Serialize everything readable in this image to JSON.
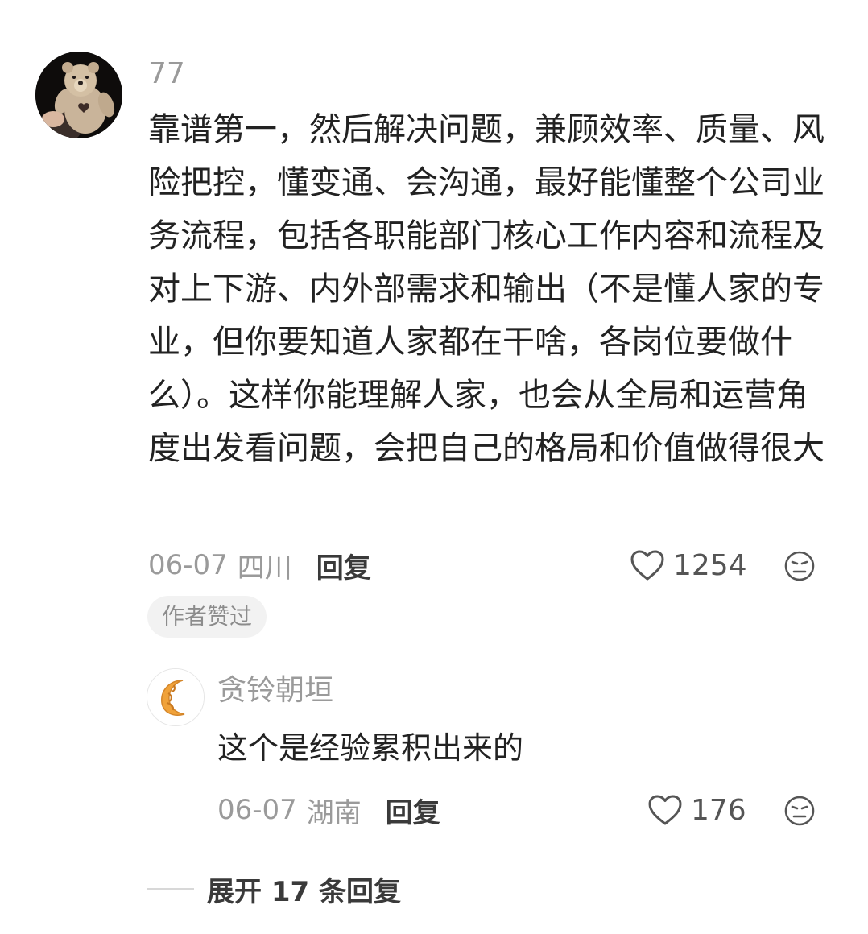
{
  "comment": {
    "username": "77",
    "text": "靠谱第一，然后解决问题，兼顾效率、质量、风险把控，懂变通、会沟通，最好能懂整个公司业务流程，包括各职能部门核心工作内容和流程及对上下游、内外部需求和输出（不是懂人家的专业，但你要知道人家都在干啥，各岗位要做什么）。这样你能理解人家，也会从全局和运营角度出发看问题，会把自己的格局和价值做得很大",
    "date": "06-07",
    "location": "四川",
    "reply_label": "回复",
    "like_count": "1254",
    "badge": "作者赞过",
    "avatar_icon": "teddy-bear-avatar-icon"
  },
  "reply": {
    "username": "贪铃朝垣",
    "text": "这个是经验累积出来的",
    "date": "06-07",
    "location": "湖南",
    "reply_label": "回复",
    "like_count": "176",
    "avatar_icon": "croissant-avatar-icon"
  },
  "expand": {
    "label": "展开 17 条回复"
  },
  "colors": {
    "muted_text": "#9a9a9a",
    "body_text": "#222222",
    "badge_bg": "#f2f2f2",
    "croissant": "#f0a23a"
  }
}
